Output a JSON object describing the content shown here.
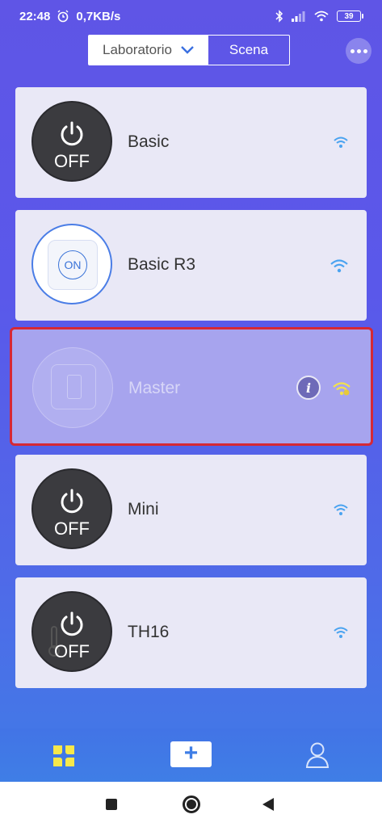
{
  "status": {
    "time": "22:48",
    "speed": "0,7KB/s",
    "battery": "39"
  },
  "header": {
    "location": "Laboratorio",
    "scene_tab": "Scena"
  },
  "devices": [
    {
      "name": "Basic",
      "state": "OFF",
      "online": true
    },
    {
      "name": "Basic R3",
      "state": "ON",
      "online": true
    },
    {
      "name": "Master",
      "state": "offline",
      "online": false
    },
    {
      "name": "Mini",
      "state": "OFF",
      "online": true
    },
    {
      "name": "TH16",
      "state": "OFF",
      "online": true
    }
  ],
  "colors": {
    "accent": "#3f7ee6",
    "offline_border": "#d62835",
    "wifi_online": "#4aa3f0",
    "wifi_offline": "#f3e24a"
  },
  "icons": {
    "home_tab": "four-petal-icon",
    "add": "plus-icon",
    "profile": "user-icon"
  },
  "tabbar": {
    "add_label": "+"
  }
}
